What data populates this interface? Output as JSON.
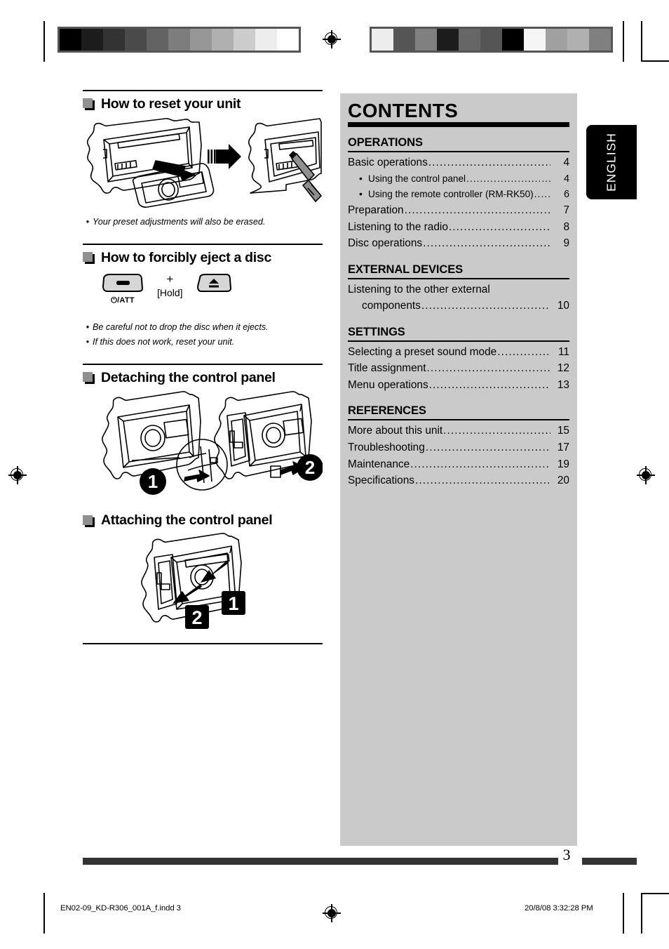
{
  "page": {
    "number": "3",
    "language_tab": "ENGLISH"
  },
  "left_column": {
    "sections": [
      {
        "id": "reset",
        "heading": "How to reset your unit",
        "notes": [
          "Your preset adjustments will also be erased."
        ]
      },
      {
        "id": "eject",
        "heading": "How to forcibly eject a disc",
        "key_combo": {
          "key1_label": "⏻/ATT",
          "plus": "+",
          "hold": "[Hold]",
          "key2_label": "eject-icon"
        },
        "notes": [
          "Be careful not to drop the disc when it ejects.",
          "If this does not work, reset your unit."
        ]
      },
      {
        "id": "detaching",
        "heading": "Detaching the control panel",
        "step_badges": [
          "1",
          "2"
        ]
      },
      {
        "id": "attaching",
        "heading": "Attaching the control panel",
        "step_badges": [
          "1",
          "2"
        ]
      }
    ]
  },
  "contents": {
    "title": "CONTENTS",
    "groups": [
      {
        "heading": "OPERATIONS",
        "entries": [
          {
            "label": "Basic operations",
            "page": "4",
            "level": 0
          },
          {
            "label": "Using the control panel",
            "page": "4",
            "level": 1
          },
          {
            "label": "Using the remote controller (RM-RK50)",
            "page": "6",
            "level": 1
          },
          {
            "label": "Preparation",
            "page": "7",
            "level": 0
          },
          {
            "label": "Listening to the radio",
            "page": "8",
            "level": 0
          },
          {
            "label": "Disc operations",
            "page": "9",
            "level": 0
          }
        ]
      },
      {
        "heading": "EXTERNAL DEVICES",
        "entries": [
          {
            "label": "Listening to the other external",
            "label2": "components",
            "page": "10",
            "level": 0,
            "wrap": true
          }
        ]
      },
      {
        "heading": "SETTINGS",
        "entries": [
          {
            "label": "Selecting a preset sound mode",
            "page": "11",
            "level": 0
          },
          {
            "label": "Title assignment",
            "page": "12",
            "level": 0
          },
          {
            "label": "Menu operations",
            "page": "13",
            "level": 0
          }
        ]
      },
      {
        "heading": "REFERENCES",
        "entries": [
          {
            "label": "More about this unit",
            "page": "15",
            "level": 0
          },
          {
            "label": "Troubleshooting",
            "page": "17",
            "level": 0
          },
          {
            "label": "Maintenance",
            "page": "19",
            "level": 0
          },
          {
            "label": "Specifications",
            "page": "20",
            "level": 0
          }
        ]
      }
    ],
    "bullet_glyph": "•",
    "leader_char": "."
  },
  "colophon": {
    "file": "EN02-09_KD-R306_001A_f.indd   3",
    "timestamp": "20/8/08   3:32:28 PM"
  },
  "calibration": {
    "left_wedge": [
      "#000000",
      "#1c1c1c",
      "#333333",
      "#4a4a4a",
      "#636363",
      "#7d7d7d",
      "#969696",
      "#b0b0b0",
      "#cccccc",
      "#ededed",
      "#ffffff"
    ],
    "right_wedge": [
      "#ededed",
      "#555555",
      "#808080",
      "#1c1c1c",
      "#666666",
      "#555555",
      "#000000",
      "#f5f5f5",
      "#a0a0a0",
      "#b0b0b0",
      "#808080"
    ]
  }
}
